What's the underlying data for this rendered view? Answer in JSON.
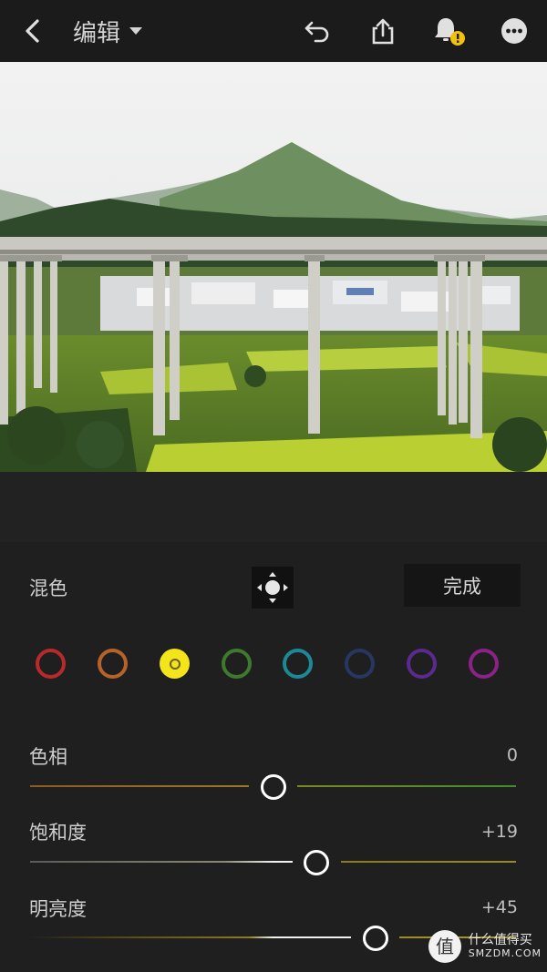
{
  "header": {
    "title": "编辑",
    "icons": [
      "back-icon",
      "dropdown-caret-icon",
      "undo-icon",
      "share-icon",
      "notification-bell-icon",
      "more-icon"
    ]
  },
  "mix_panel": {
    "label": "混色",
    "done_label": "完成",
    "colors": [
      {
        "name": "red",
        "color": "#b82a2a"
      },
      {
        "name": "orange",
        "color": "#b5632a"
      },
      {
        "name": "yellow",
        "color": "#f4e41a"
      },
      {
        "name": "green",
        "color": "#3e7a2d"
      },
      {
        "name": "aqua",
        "color": "#1e8996"
      },
      {
        "name": "blue",
        "color": "#283762"
      },
      {
        "name": "purple",
        "color": "#5b2a8f"
      },
      {
        "name": "magenta",
        "color": "#8b2288"
      }
    ],
    "selected_color": "yellow"
  },
  "sliders": [
    {
      "label": "色相",
      "value": "0",
      "level": 0.5
    },
    {
      "label": "饱和度",
      "value": "+19",
      "level": 0.59
    },
    {
      "label": "明亮度",
      "value": "+45",
      "level": 0.72
    }
  ],
  "watermark": {
    "cn": "什么值得买",
    "en": "SMZDM.COM",
    "badge": "值"
  }
}
